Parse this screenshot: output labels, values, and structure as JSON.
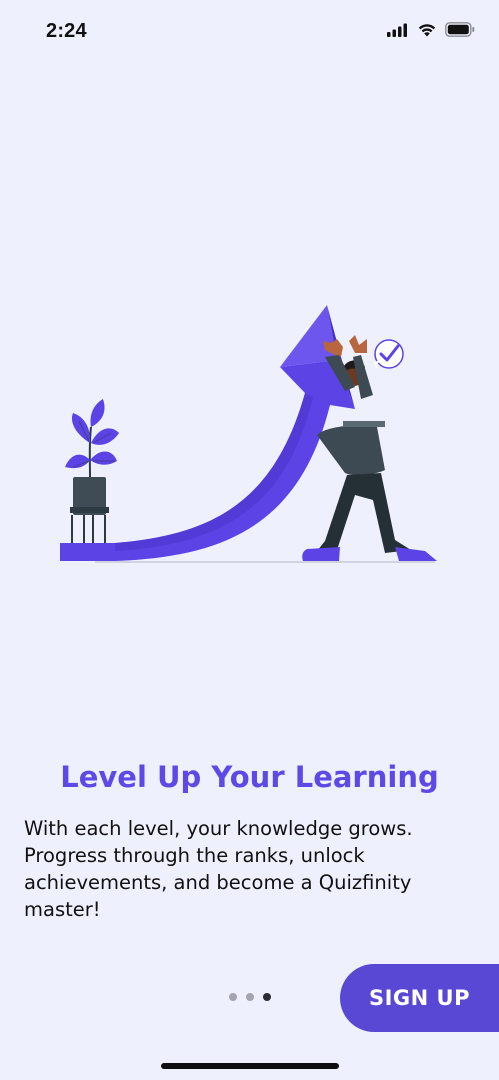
{
  "status_bar": {
    "time": "2:24",
    "icons": [
      "cellular-signal-icon",
      "wifi-icon",
      "battery-icon"
    ]
  },
  "onboarding": {
    "title": "Level Up Your Learning",
    "description": "With each level, your knowledge grows. Progress through the ranks, unlock achievements, and become a Quizfinity master!",
    "page_indicator": {
      "total": 3,
      "current": 3
    }
  },
  "actions": {
    "signup_label": "SIGN UP"
  },
  "colors": {
    "background": "#EFF0FD",
    "accent": "#5E49E6",
    "button": "#5848D3",
    "arrow": "#5B43E6"
  }
}
